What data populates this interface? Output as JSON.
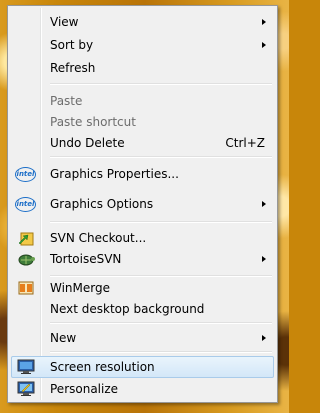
{
  "menu": {
    "items": [
      {
        "id": "view",
        "label": "View",
        "submenu": true
      },
      {
        "id": "sort",
        "label": "Sort by",
        "submenu": true
      },
      {
        "id": "refresh",
        "label": "Refresh"
      },
      {
        "id": "paste",
        "label": "Paste",
        "disabled": true
      },
      {
        "id": "paste_shortcut",
        "label": "Paste shortcut",
        "disabled": true
      },
      {
        "id": "undo",
        "label": "Undo Delete",
        "accel": "Ctrl+Z"
      },
      {
        "id": "gfx_props",
        "label": "Graphics Properties...",
        "icon": "intel-icon"
      },
      {
        "id": "gfx_opts",
        "label": "Graphics Options",
        "icon": "intel-icon",
        "submenu": true
      },
      {
        "id": "svn_checkout",
        "label": "SVN Checkout...",
        "icon": "svn-checkout-icon"
      },
      {
        "id": "tortoise",
        "label": "TortoiseSVN",
        "icon": "tortoisesvn-icon",
        "submenu": true
      },
      {
        "id": "winmerge",
        "label": "WinMerge",
        "icon": "winmerge-icon"
      },
      {
        "id": "next_bg",
        "label": "Next desktop background"
      },
      {
        "id": "new",
        "label": "New",
        "submenu": true
      },
      {
        "id": "screen_res",
        "label": "Screen resolution",
        "icon": "monitor-icon",
        "highlighted": true
      },
      {
        "id": "personalize",
        "label": "Personalize",
        "icon": "personalize-icon"
      }
    ],
    "intel_text": "intel"
  }
}
